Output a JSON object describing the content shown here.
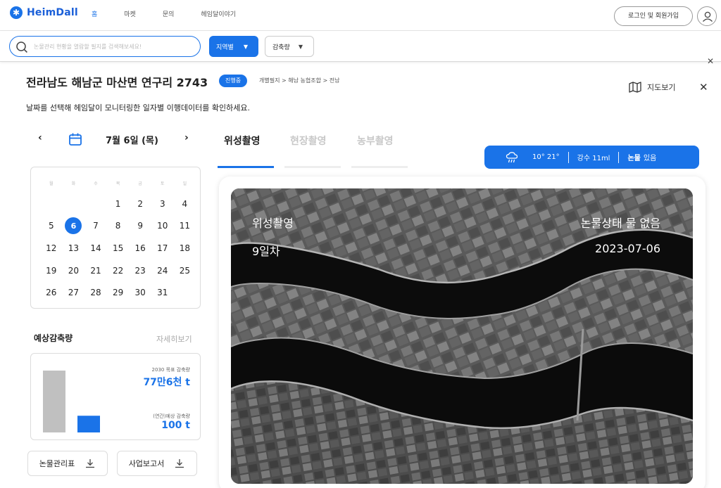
{
  "brand": {
    "name": "HeimDall"
  },
  "nav": {
    "items": [
      "홈",
      "마켓",
      "문의",
      "헤임달이야기"
    ],
    "active_index": 0
  },
  "header_actions": {
    "login_label": "로그인 및 회원가입"
  },
  "search": {
    "placeholder": "논물관리 현황을 열람할 필지를 검색해보세요!",
    "value": ""
  },
  "filters": {
    "region_label": "지역별",
    "reduction_label": "감축량"
  },
  "field": {
    "title": "전라남도 해남군 마산면 연구리 2743",
    "status": "진행중",
    "breadcrumb": "개별필지 > 해남 농협조합 > 전남",
    "subtitle": "날짜를 선택해 헤임달이 모니터링한 일자별 이행데이터를 확인하세요.",
    "map_label": "지도보기"
  },
  "date_nav": {
    "prev": "‹",
    "next": "›",
    "label": "7월 6일 (목)"
  },
  "calendar": {
    "weekdays": [
      "월",
      "화",
      "수",
      "목",
      "금",
      "토",
      "일"
    ],
    "days": [
      "",
      "",
      "",
      "1",
      "2",
      "3",
      "4",
      "5",
      "6",
      "7",
      "8",
      "9",
      "10",
      "11",
      "12",
      "13",
      "14",
      "15",
      "16",
      "17",
      "18",
      "19",
      "20",
      "21",
      "22",
      "23",
      "24",
      "25",
      "26",
      "27",
      "28",
      "29",
      "30",
      "31",
      ""
    ],
    "selected_day": "6"
  },
  "reduction": {
    "title": "예상감축량",
    "more_label": "자세히보기",
    "target_label": "2030 목표 감축량",
    "target_value": "77만6천 t",
    "annual_label": "(연간)예상 감축량",
    "annual_value": "100 t"
  },
  "chart_data": {
    "type": "bar",
    "categories": [
      "2030 목표 감축량",
      "(연간)예상 감축량"
    ],
    "values": [
      776000,
      100
    ],
    "colors": [
      "#c0c0c0",
      "#1a73e8"
    ],
    "note_scale": "schematic (bars not to true scale)",
    "display_fractions": [
      1.0,
      0.27
    ]
  },
  "downloads": {
    "table_label": "논물관리표",
    "report_label": "사업보고서"
  },
  "tabs": {
    "items": [
      "위성촬영",
      "현장촬영",
      "농부촬영"
    ],
    "active_index": 0
  },
  "weather": {
    "temp": "10° 21°",
    "rain": "강수 11ml",
    "water_label": "논물",
    "water_value": "있음"
  },
  "image": {
    "title": "위성촬영",
    "day": "9일차",
    "status": "논물상태 물 없음",
    "date": "2023-07-06"
  },
  "colors": {
    "accent": "#1a73e8",
    "bar_gray": "#c0c0c0"
  }
}
